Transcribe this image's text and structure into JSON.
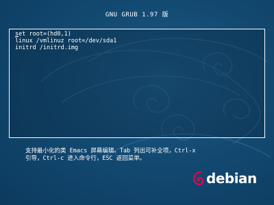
{
  "header": {
    "title": "GNU GRUB  1.97 版"
  },
  "editor": {
    "lines": [
      "set root=(hd0,1)",
      "linux /vmlinuz root=/dev/sda1",
      "initrd /initrd.img"
    ]
  },
  "help": {
    "lines": [
      "支持最小化的类 Emacs 屏幕编辑。Tab 列出可补全项，Ctrl-x",
      "引导，Ctrl-c 进入命令行，ESC 返回菜单。"
    ]
  },
  "logo": {
    "text": "debian",
    "swirl_color": "#d70a53"
  },
  "colors": {
    "background": "#134a72",
    "text": "#ffffff"
  }
}
